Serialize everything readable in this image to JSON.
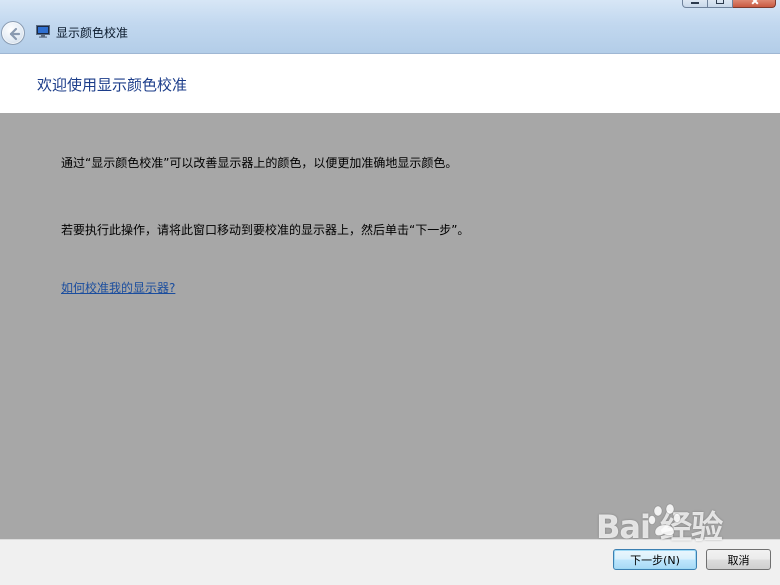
{
  "window": {
    "title": "显示颜色校准",
    "icons": {
      "back": "back-arrow-icon",
      "app": "display-monitor-icon"
    }
  },
  "header": {
    "title": "欢迎使用显示颜色校准"
  },
  "content": {
    "intro": "通过“显示颜色校准”可以改善显示器上的颜色，以便更加准确地显示颜色。",
    "instruction": "若要执行此操作，请将此窗口移动到要校准的显示器上，然后单击“下一步”。",
    "help_link": "如何校准我的显示器?"
  },
  "footer": {
    "next_label": "下一步(N)",
    "cancel_label": "取消"
  },
  "watermark": {
    "text": "Bai  经验"
  },
  "colors": {
    "title_blue": "#1c3d8a",
    "content_gray": "#a7a7a7",
    "link_blue": "#1a4d9e",
    "header_white": "#ffffff",
    "footer_gray": "#f0f0f0"
  }
}
